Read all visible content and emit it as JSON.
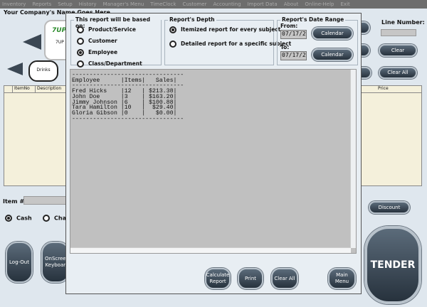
{
  "menu": [
    "Inventory",
    "Reports",
    "Setup",
    "History",
    "Manager's Menu",
    "TimeClock",
    "Customer",
    "Accounting",
    "Import Data",
    "About",
    "Online-Help",
    "Exit"
  ],
  "company_name": "Your Company's Name Goes Here",
  "product_button": {
    "logo": "7UP",
    "label": "7UP"
  },
  "category_button": "Drinks",
  "left_table_headers": [
    "ItemNo",
    "Description"
  ],
  "right_table_headers": [
    "Price"
  ],
  "line_number_label": "Line Number:",
  "clear_label": "Clear",
  "clear_all_label": "Clear All",
  "item_label": "Item #",
  "payment": {
    "cash": "Cash",
    "charge": "Char",
    "selected": "Cash"
  },
  "logout_label": "Log-Out",
  "keyboard_label": "OnScreen Keyboard",
  "discount_label": "Discount",
  "tender_label": "TENDER",
  "dialog": {
    "based_on": {
      "title": "This report will be based on:",
      "options": [
        "Product/Service",
        "Customer",
        "Employee",
        "Class/Department"
      ],
      "selected": "Employee"
    },
    "depth": {
      "title": "Report's Depth",
      "options": [
        "Itemized report for every subject",
        "Detailed report for a specific subject"
      ],
      "selected": "Itemized report for every subject"
    },
    "date_range": {
      "title": "Report's Date Range",
      "from_label": "From:",
      "from_value": "07/17/2",
      "to_label": "To:",
      "to_value": "07/17/2",
      "calendar_label": "Calendar"
    },
    "report": {
      "headers": [
        "Employee",
        "Items",
        "Sales"
      ],
      "rows": [
        [
          "Fred Hicks",
          "12",
          "$213.38"
        ],
        [
          "John Doe",
          "3",
          "$163.20"
        ],
        [
          "Jimmy Johnson",
          "6",
          "$100.88"
        ],
        [
          "Tara Hamilton",
          "10",
          "$29.40"
        ],
        [
          "Gloria Gibson",
          "0",
          "$0.00"
        ]
      ]
    },
    "buttons": {
      "calculate": "Calculate Report",
      "print": "Print",
      "clear_all": "Clear All",
      "main_menu": "Main Menu"
    }
  }
}
